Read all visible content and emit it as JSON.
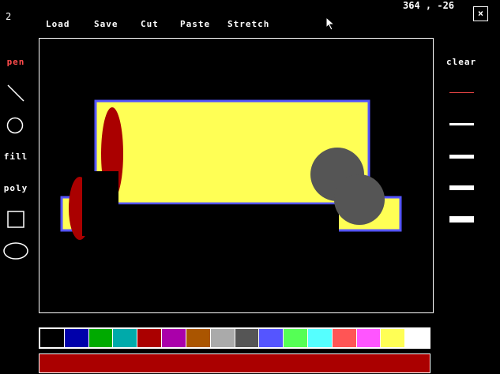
{
  "top_left_number": "2",
  "coords": "364 , -26",
  "close_label": "×",
  "menu": [
    "Load",
    "Save",
    "Cut",
    "Paste",
    "Stretch"
  ],
  "tools": {
    "pen": "pen",
    "fill": "fill",
    "poly": "poly",
    "clear": "clear"
  },
  "colors": {
    "active_tool": "#ff4b4b",
    "current_color": "#aa0000"
  },
  "palette": [
    "#000000",
    "#0000aa",
    "#00aa00",
    "#00aaaa",
    "#aa0000",
    "#aa00aa",
    "#aa5500",
    "#aaaaaa",
    "#555555",
    "#5555ff",
    "#55ff55",
    "#55ffff",
    "#ff5555",
    "#ff55ff",
    "#ffff55",
    "#ffffff"
  ]
}
